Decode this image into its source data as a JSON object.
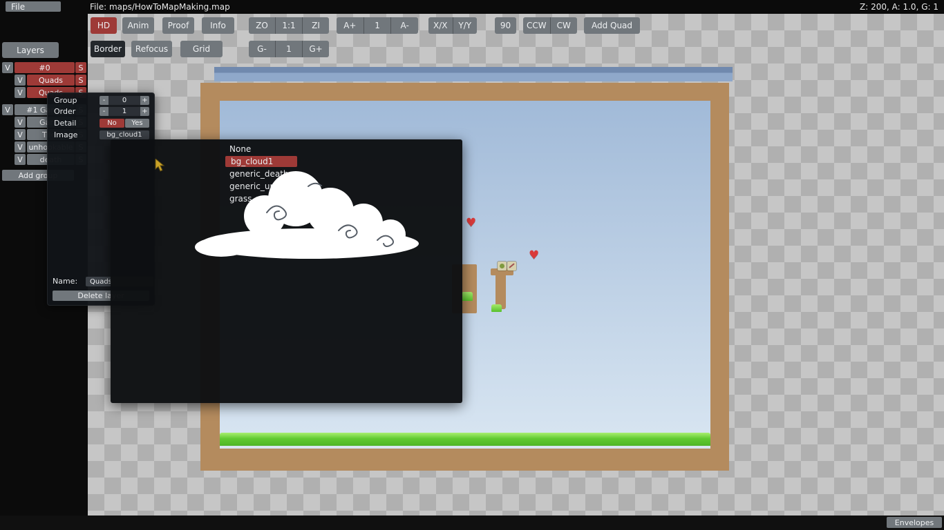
{
  "topbar": {
    "file_button": "File",
    "file_path": "File: maps/HowToMapMaking.map",
    "status": "Z: 200, A: 1.0, G: 1"
  },
  "toolbar": {
    "mode_buttons": [
      "HD",
      "Anim",
      "Proof",
      "Info"
    ],
    "zoom_group": [
      "ZO",
      "1:1",
      "ZI"
    ],
    "anim_group": [
      "A+",
      "1",
      "A-"
    ],
    "mirror_group": [
      "X/X",
      "Y/Y"
    ],
    "rotate_value": "90",
    "rotate_group": [
      "CCW",
      "CW"
    ],
    "add_quad": "Add Quad",
    "row2_buttons": [
      "Border",
      "Refocus",
      "Grid"
    ],
    "grid_group": [
      "G-",
      "1",
      "G+"
    ]
  },
  "sidebar": {
    "layers": "Layers",
    "rows": [
      {
        "v": "V",
        "label": "#0",
        "s": "S"
      },
      {
        "v": "V",
        "label": "Quads",
        "s": "S"
      },
      {
        "v": "V",
        "label": "Quads",
        "s": "S"
      },
      {
        "v": "V",
        "label": "#1 Game",
        "s": "S"
      },
      {
        "v": "V",
        "label": "Game",
        "s": "S"
      },
      {
        "v": "V",
        "label": "Tiles",
        "s": "S"
      },
      {
        "v": "V",
        "label": "unhookable",
        "s": "S"
      },
      {
        "v": "V",
        "label": "death",
        "s": "S"
      }
    ],
    "add_group": "Add group"
  },
  "layer_popup": {
    "group_label": "Group",
    "group_value": "0",
    "order_label": "Order",
    "order_value": "1",
    "detail_label": "Detail",
    "detail_no": "No",
    "detail_yes": "Yes",
    "image_label": "Image",
    "image_value": "bg_cloud1",
    "minus": "-",
    "plus": "+",
    "name_label": "Name:",
    "name_value": "Quads",
    "delete_button": "Delete layer"
  },
  "image_picker": {
    "items": [
      "None",
      "bg_cloud1",
      "generic_death",
      "generic_unho",
      "grass_main"
    ],
    "selected": "bg_cloud1"
  },
  "map": {
    "heart": "♥"
  },
  "bottombar": {
    "envelopes": "Envelopes"
  }
}
